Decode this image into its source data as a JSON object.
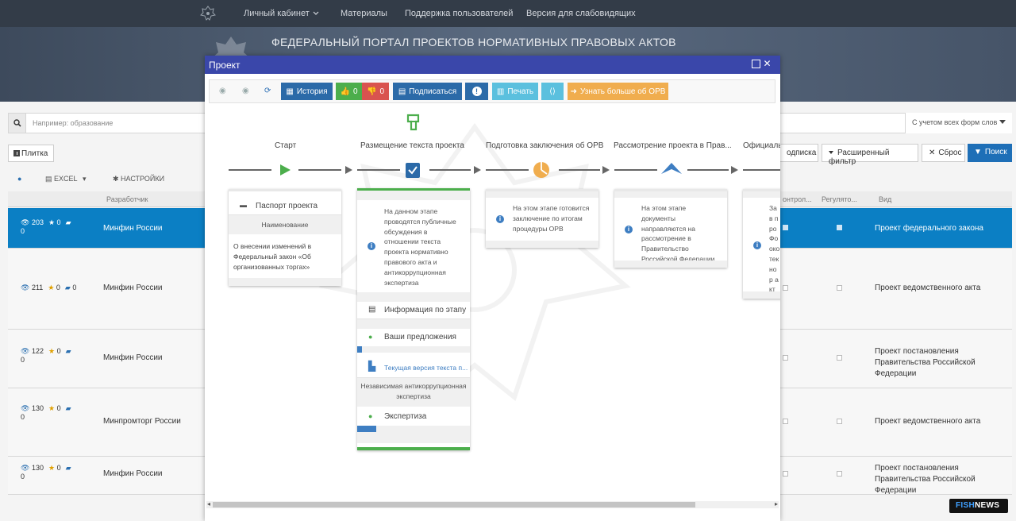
{
  "topnav": {
    "items": [
      "Личный кабинет",
      "Материалы",
      "Поддержка пользователей",
      "Версия для слабовидящих"
    ]
  },
  "banner": {
    "portal_title": "ФЕДЕРАЛЬНЫЙ ПОРТАЛ ПРОЕКТОВ НОРМАТИВНЫХ ПРАВОВЫХ АКТОВ"
  },
  "search": {
    "placeholder": "Например: образование",
    "morph_option": "С учетом всех форм слов"
  },
  "view": {
    "tile_label": "Плитка"
  },
  "filters": {
    "subscribe": "одписка",
    "advanced": "Расширенный фильтр",
    "reset": "Сброс",
    "search": "Поиск"
  },
  "toolbar2": {
    "excel": "EXCEL",
    "settings": "НАСТРОЙКИ"
  },
  "table": {
    "headers": {
      "developer": "Разработчик",
      "control": "онтрол...",
      "regulatory": "Регулято...",
      "kind": "Вид"
    },
    "rows": [
      {
        "views": "203",
        "stars": "0",
        "comments": "",
        "extra": "0",
        "developer": "Минфин России",
        "kind": "Проект федерального закона",
        "selected": true
      },
      {
        "views": "211",
        "stars": "0",
        "comments": "0",
        "extra": "",
        "developer": "Минфин России",
        "kind": "Проект ведомственного акта",
        "selected": false
      },
      {
        "views": "122",
        "stars": "0",
        "comments": "",
        "extra": "0",
        "developer": "Минфин России",
        "kind": "Проект постановления Правительства Российской Федерации",
        "selected": false
      },
      {
        "views": "130",
        "stars": "0",
        "comments": "",
        "extra": "0",
        "developer": "Минпромторг России",
        "kind": "Проект ведомственного акта",
        "selected": false
      },
      {
        "views": "130",
        "stars": "0",
        "comments": "",
        "extra": "0",
        "developer": "Минфин России",
        "kind": "Проект постановления Правительства Российской Федерации",
        "selected": false
      }
    ]
  },
  "modal": {
    "title": "Проект",
    "toolbar": {
      "history": "История",
      "likes": "0",
      "dislikes": "0",
      "subscribe": "Подписаться",
      "print": "Печать",
      "learn_more": "Узнать больше об ОРВ"
    },
    "stages": [
      {
        "title": "Старт"
      },
      {
        "title": "Размещение текста проекта"
      },
      {
        "title": "Подготовка заключения об ОРВ"
      },
      {
        "title": "Рассмотрение проекта в Прав..."
      },
      {
        "title": "Официальн"
      }
    ],
    "start_card": {
      "passport": "Паспорт проекта",
      "name_header": "Наименование",
      "name_value": "О внесении изменений в Федеральный закон «Об организованных торгах»"
    },
    "placement_card": {
      "info": "На данном этапе проводятся публичные обсуждения в отношении текста проекта нормативно правового акта и антикоррупционная экспертиза",
      "stage_info": "Информация по этапу",
      "proposals": "Ваши предложения",
      "current_version": "Текущая версия текста п...",
      "anticorruption": "Независимая антикоррупционная экспертиза",
      "expertise": "Экспертиза"
    },
    "orv_card": {
      "info": "На этом этапе готовится заключение по итогам процедуры ОРВ"
    },
    "gov_card": {
      "info": "На этом этапе документы направляются на рассмотрение в Правительство Российской Федерации"
    },
    "official_card": {
      "info": "Зав про Фо око тек нор акт"
    }
  },
  "brand": {
    "fishnews": "FISH",
    "fishnews_bold": "NEWS"
  }
}
